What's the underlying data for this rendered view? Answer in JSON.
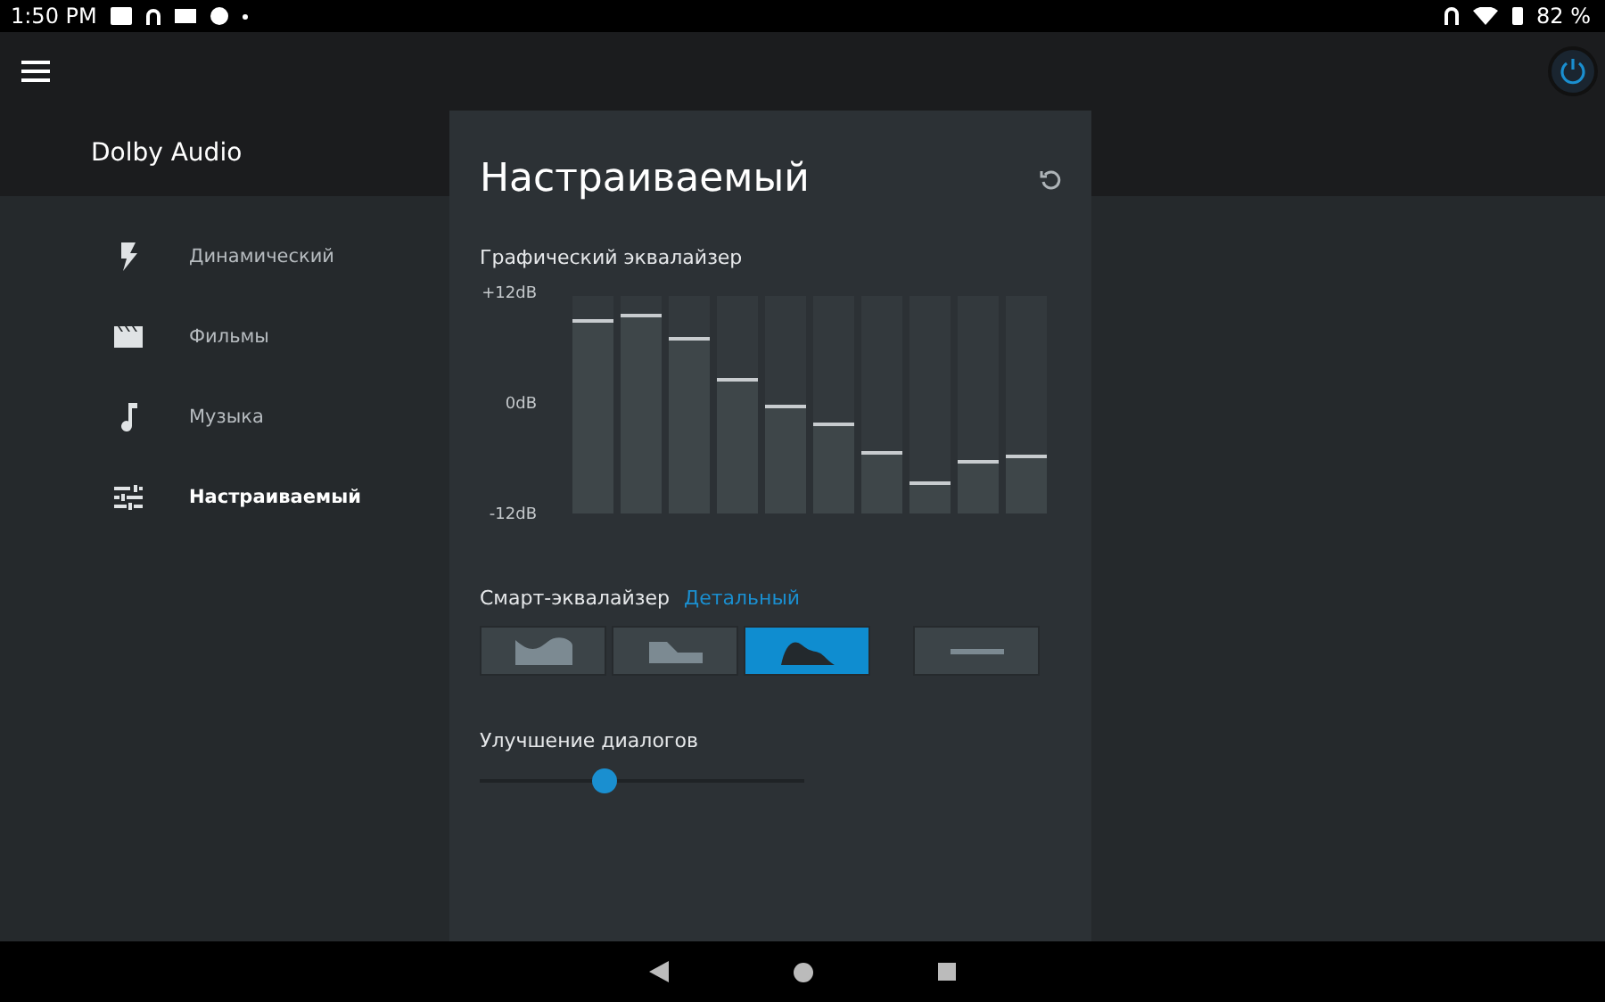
{
  "status_bar": {
    "time": "1:50 PM",
    "battery": "82 %"
  },
  "app": {
    "title": "Dolby Audio"
  },
  "profiles": [
    {
      "label": "Динамический",
      "kind": "dynamic",
      "selected": false
    },
    {
      "label": "Фильмы",
      "kind": "movie",
      "selected": false
    },
    {
      "label": "Музыка",
      "kind": "music",
      "selected": false
    },
    {
      "label": "Настраиваемый",
      "kind": "custom",
      "selected": true
    }
  ],
  "panel": {
    "title": "Настраиваемый",
    "graphic_eq": {
      "label": "Графический эквалайзер",
      "scale": [
        "+12dB",
        "0dB",
        "-12dB"
      ],
      "bands": [
        {
          "level": 0.89
        },
        {
          "level": 0.92
        },
        {
          "level": 0.81
        },
        {
          "level": 0.62
        },
        {
          "level": 0.5
        },
        {
          "level": 0.42
        },
        {
          "level": 0.29
        },
        {
          "level": 0.15
        },
        {
          "level": 0.25
        },
        {
          "level": 0.27
        }
      ]
    },
    "smart_eq": {
      "label": "Смарт-эквалайзер",
      "value": "Детальный",
      "presets": [
        {
          "kind": "open",
          "selected": false
        },
        {
          "kind": "rich",
          "selected": false
        },
        {
          "kind": "focused",
          "selected": true
        },
        {
          "kind": "off",
          "selected": false
        }
      ]
    },
    "dialogue": {
      "label": "Улучшение диалогов",
      "level": 0.385
    }
  }
}
